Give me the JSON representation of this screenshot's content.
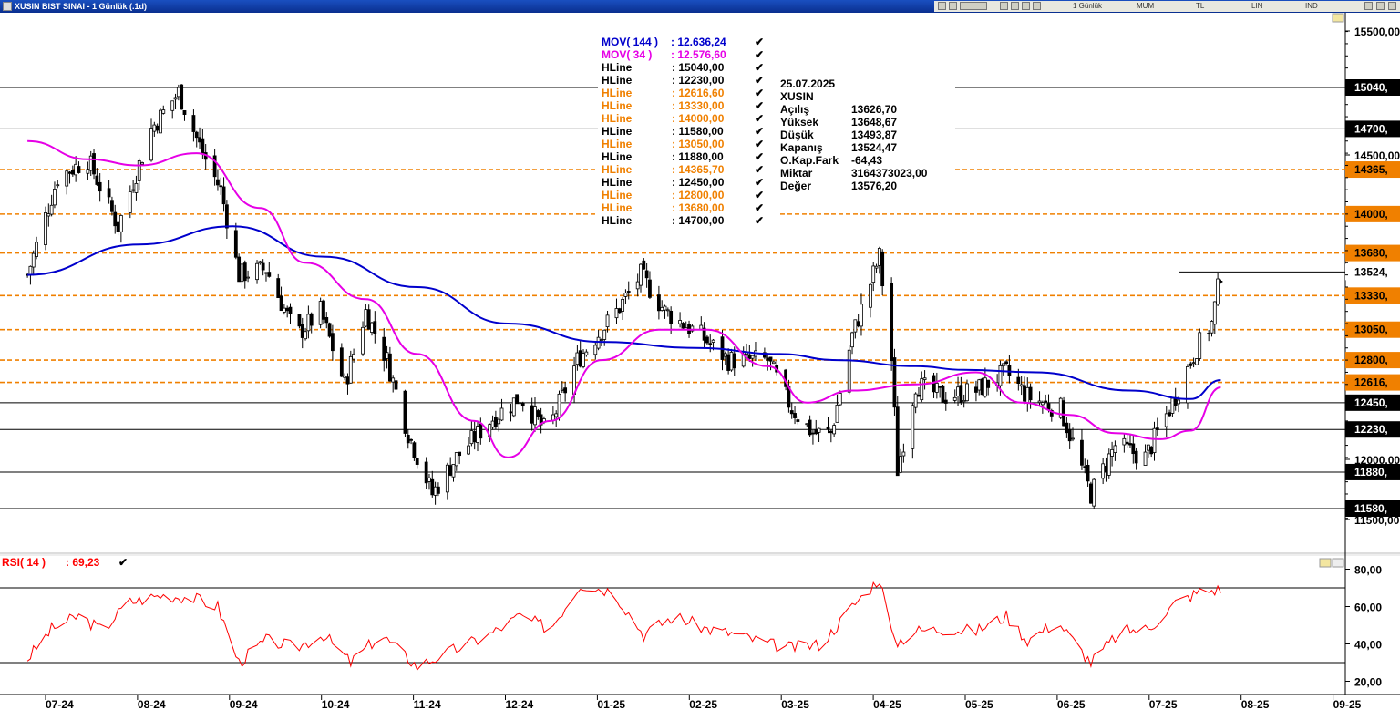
{
  "window": {
    "title": "XUSIN BIST SINAI - 1 Günlük (.1d)",
    "toolbar": [
      "1 Günlük",
      "MUM",
      "TL",
      "LIN",
      "IND"
    ]
  },
  "indicators": {
    "mov144": {
      "label": "MOV( 144 )",
      "value": ": 12.636,24",
      "color": "#0000cc"
    },
    "mov34": {
      "label": "MOV( 34 )",
      "value": ": 12.576,60",
      "color": "#e600e6"
    },
    "hlines": [
      {
        "label": "HLine",
        "value": ": 15040,00",
        "color": "#000000"
      },
      {
        "label": "HLine",
        "value": ": 12230,00",
        "color": "#000000"
      },
      {
        "label": "HLine",
        "value": ": 12616,60",
        "color": "#f08000"
      },
      {
        "label": "HLine",
        "value": ": 13330,00",
        "color": "#f08000"
      },
      {
        "label": "HLine",
        "value": ": 14000,00",
        "color": "#f08000"
      },
      {
        "label": "HLine",
        "value": ": 11580,00",
        "color": "#000000"
      },
      {
        "label": "HLine",
        "value": ": 13050,00",
        "color": "#f08000"
      },
      {
        "label": "HLine",
        "value": ": 11880,00",
        "color": "#000000"
      },
      {
        "label": "HLine",
        "value": ": 14365,70",
        "color": "#f08000"
      },
      {
        "label": "HLine",
        "value": ": 12450,00",
        "color": "#000000"
      },
      {
        "label": "HLine",
        "value": ": 12800,00",
        "color": "#f08000"
      },
      {
        "label": "HLine",
        "value": ": 13680,00",
        "color": "#f08000"
      },
      {
        "label": "HLine",
        "value": ": 14700,00",
        "color": "#000000"
      }
    ],
    "rsi": {
      "label": "RSI( 14 )",
      "value": ": 69,23",
      "color": "#ff0000"
    }
  },
  "info_box": {
    "date": "25.07.2025",
    "symbol": "XUSIN",
    "rows": [
      {
        "key": "Açılış",
        "value": "13626,70"
      },
      {
        "key": "Yüksek",
        "value": "13648,67"
      },
      {
        "key": "Düşük",
        "value": "13493,87"
      },
      {
        "key": "Kapanış",
        "value": "13524,47"
      },
      {
        "key": "O.Kap.Fark",
        "value": "-64,43"
      },
      {
        "key": "Miktar",
        "value": "3164373023,00"
      },
      {
        "key": "Değer",
        "value": "13576,20"
      }
    ]
  },
  "chart_data": [
    {
      "type": "candlestick",
      "symbol": "XUSIN",
      "x_tick_labels": [
        "07-24",
        "08-24",
        "09-24",
        "10-24",
        "11-24",
        "12-24",
        "01-25",
        "02-25",
        "03-25",
        "04-25",
        "05-25",
        "06-25",
        "07-25",
        "08-25",
        "09-25"
      ],
      "y_tick_labels": [
        "15500,00",
        "14500,00",
        "12000,00",
        "11500,00"
      ],
      "ylim": [
        11450,
        15600
      ],
      "hline_levels": [
        {
          "value": 15040,
          "label": "15040,",
          "style": "solid",
          "color": "#000000"
        },
        {
          "value": 14700,
          "label": "14700,",
          "style": "solid",
          "color": "#000000"
        },
        {
          "value": 14365.7,
          "label": "14365,",
          "style": "dashed",
          "color": "#f08000"
        },
        {
          "value": 14000,
          "label": "14000,",
          "style": "dashed",
          "color": "#f08000"
        },
        {
          "value": 13680,
          "label": "13680,",
          "style": "dashed",
          "color": "#f08000"
        },
        {
          "value": 13330,
          "label": "13330,",
          "style": "dashed",
          "color": "#f08000"
        },
        {
          "value": 13050,
          "label": "13050,",
          "style": "dashed",
          "color": "#f08000"
        },
        {
          "value": 12800,
          "label": "12800,",
          "style": "dashed",
          "color": "#f08000"
        },
        {
          "value": 12616.6,
          "label": "12616,",
          "style": "dashed",
          "color": "#f08000"
        },
        {
          "value": 12450,
          "label": "12450,",
          "style": "solid",
          "color": "#000000"
        },
        {
          "value": 12230,
          "label": "12230,",
          "style": "solid",
          "color": "#000000"
        },
        {
          "value": 11880,
          "label": "11880,",
          "style": "solid",
          "color": "#000000"
        },
        {
          "value": 11580,
          "label": "11580,",
          "style": "solid",
          "color": "#000000"
        }
      ],
      "last_price": {
        "value": 13524.47,
        "label": "13524,"
      },
      "close_path": [
        [
          "2024-06-25",
          13500
        ],
        [
          "2024-07-05",
          14300
        ],
        [
          "2024-07-15",
          14450
        ],
        [
          "2024-07-25",
          13900
        ],
        [
          "2024-08-05",
          14700
        ],
        [
          "2024-08-14",
          15000
        ],
        [
          "2024-08-22",
          14500
        ],
        [
          "2024-08-28",
          14200
        ],
        [
          "2024-09-03",
          13500
        ],
        [
          "2024-09-12",
          13550
        ],
        [
          "2024-09-22",
          13000
        ],
        [
          "2024-09-30",
          13200
        ],
        [
          "2024-10-08",
          12600
        ],
        [
          "2024-10-15",
          13200
        ],
        [
          "2024-10-22",
          12800
        ],
        [
          "2024-10-29",
          12200
        ],
        [
          "2024-11-06",
          11700
        ],
        [
          "2024-11-14",
          12000
        ],
        [
          "2024-11-25",
          12300
        ],
        [
          "2024-12-05",
          12500
        ],
        [
          "2024-12-14",
          12200
        ],
        [
          "2024-12-24",
          12800
        ],
        [
          "2025-01-06",
          13200
        ],
        [
          "2025-01-14",
          13500
        ],
        [
          "2025-01-22",
          13200
        ],
        [
          "2025-02-03",
          13000
        ],
        [
          "2025-02-12",
          12800
        ],
        [
          "2025-02-25",
          12800
        ],
        [
          "2025-03-05",
          12400
        ],
        [
          "2025-03-12",
          12200
        ],
        [
          "2025-03-18",
          12200
        ],
        [
          "2025-03-25",
          13000
        ],
        [
          "2025-04-03",
          13650
        ],
        [
          "2025-04-07",
          12800
        ],
        [
          "2025-04-09",
          11900
        ],
        [
          "2025-04-15",
          12600
        ],
        [
          "2025-04-24",
          12500
        ],
        [
          "2025-05-05",
          12550
        ],
        [
          "2025-05-15",
          12700
        ],
        [
          "2025-05-22",
          12500
        ],
        [
          "2025-06-02",
          12400
        ],
        [
          "2025-06-12",
          11700
        ],
        [
          "2025-06-20",
          12100
        ],
        [
          "2025-06-30",
          12000
        ],
        [
          "2025-07-10",
          12500
        ],
        [
          "2025-07-17",
          12900
        ],
        [
          "2025-07-22",
          13100
        ],
        [
          "2025-07-25",
          13524
        ]
      ],
      "mov144_path": [
        [
          "2024-06-25",
          13500
        ],
        [
          "2024-08-01",
          13750
        ],
        [
          "2024-09-01",
          13900
        ],
        [
          "2024-10-01",
          13650
        ],
        [
          "2024-11-01",
          13400
        ],
        [
          "2024-12-01",
          13100
        ],
        [
          "2025-01-01",
          12950
        ],
        [
          "2025-02-01",
          12900
        ],
        [
          "2025-03-01",
          12850
        ],
        [
          "2025-03-20",
          12800
        ],
        [
          "2025-04-15",
          12750
        ],
        [
          "2025-05-01",
          12720
        ],
        [
          "2025-05-25",
          12700
        ],
        [
          "2025-06-25",
          12550
        ],
        [
          "2025-07-15",
          12480
        ],
        [
          "2025-07-25",
          12636
        ]
      ],
      "mov34_path": [
        [
          "2024-06-25",
          14600
        ],
        [
          "2024-07-15",
          14450
        ],
        [
          "2024-08-01",
          14400
        ],
        [
          "2024-08-20",
          14500
        ],
        [
          "2024-09-10",
          14050
        ],
        [
          "2024-09-25",
          13600
        ],
        [
          "2024-10-15",
          13300
        ],
        [
          "2024-11-01",
          12850
        ],
        [
          "2024-11-20",
          12300
        ],
        [
          "2024-12-01",
          12000
        ],
        [
          "2024-12-15",
          12300
        ],
        [
          "2025-01-01",
          12800
        ],
        [
          "2025-01-20",
          13050
        ],
        [
          "2025-02-05",
          13050
        ],
        [
          "2025-02-25",
          12750
        ],
        [
          "2025-03-10",
          12450
        ],
        [
          "2025-03-25",
          12550
        ],
        [
          "2025-04-15",
          12600
        ],
        [
          "2025-05-05",
          12700
        ],
        [
          "2025-05-20",
          12450
        ],
        [
          "2025-06-05",
          12350
        ],
        [
          "2025-06-20",
          12200
        ],
        [
          "2025-07-05",
          12150
        ],
        [
          "2025-07-15",
          12220
        ],
        [
          "2025-07-25",
          12576
        ]
      ]
    },
    {
      "type": "line",
      "name": "RSI( 14 )",
      "y_tick_labels": [
        "80,00",
        "60,00",
        "40,00",
        "20,00"
      ],
      "ylim": [
        15,
        85
      ],
      "reference_lines": [
        70,
        30
      ],
      "path": [
        [
          "2024-06-25",
          32
        ],
        [
          "2024-07-03",
          48
        ],
        [
          "2024-07-12",
          55
        ],
        [
          "2024-07-20",
          47
        ],
        [
          "2024-07-28",
          62
        ],
        [
          "2024-08-08",
          66
        ],
        [
          "2024-08-18",
          65
        ],
        [
          "2024-08-27",
          60
        ],
        [
          "2024-09-03",
          30
        ],
        [
          "2024-09-12",
          42
        ],
        [
          "2024-09-22",
          38
        ],
        [
          "2024-10-01",
          45
        ],
        [
          "2024-10-10",
          30
        ],
        [
          "2024-10-20",
          45
        ],
        [
          "2024-11-01",
          28
        ],
        [
          "2024-11-12",
          36
        ],
        [
          "2024-11-25",
          45
        ],
        [
          "2024-12-05",
          55
        ],
        [
          "2024-12-15",
          48
        ],
        [
          "2024-12-25",
          72
        ],
        [
          "2025-01-05",
          68
        ],
        [
          "2025-01-15",
          45
        ],
        [
          "2025-01-25",
          55
        ],
        [
          "2025-02-05",
          48
        ],
        [
          "2025-02-15",
          45
        ],
        [
          "2025-02-25",
          40
        ],
        [
          "2025-03-05",
          38
        ],
        [
          "2025-03-15",
          40
        ],
        [
          "2025-03-25",
          60
        ],
        [
          "2025-04-03",
          75
        ],
        [
          "2025-04-08",
          40
        ],
        [
          "2025-04-15",
          47
        ],
        [
          "2025-04-25",
          48
        ],
        [
          "2025-05-05",
          47
        ],
        [
          "2025-05-15",
          55
        ],
        [
          "2025-05-22",
          42
        ],
        [
          "2025-06-01",
          52
        ],
        [
          "2025-06-12",
          30
        ],
        [
          "2025-06-22",
          47
        ],
        [
          "2025-07-01",
          48
        ],
        [
          "2025-07-10",
          62
        ],
        [
          "2025-07-18",
          68
        ],
        [
          "2025-07-25",
          69.23
        ]
      ]
    }
  ]
}
